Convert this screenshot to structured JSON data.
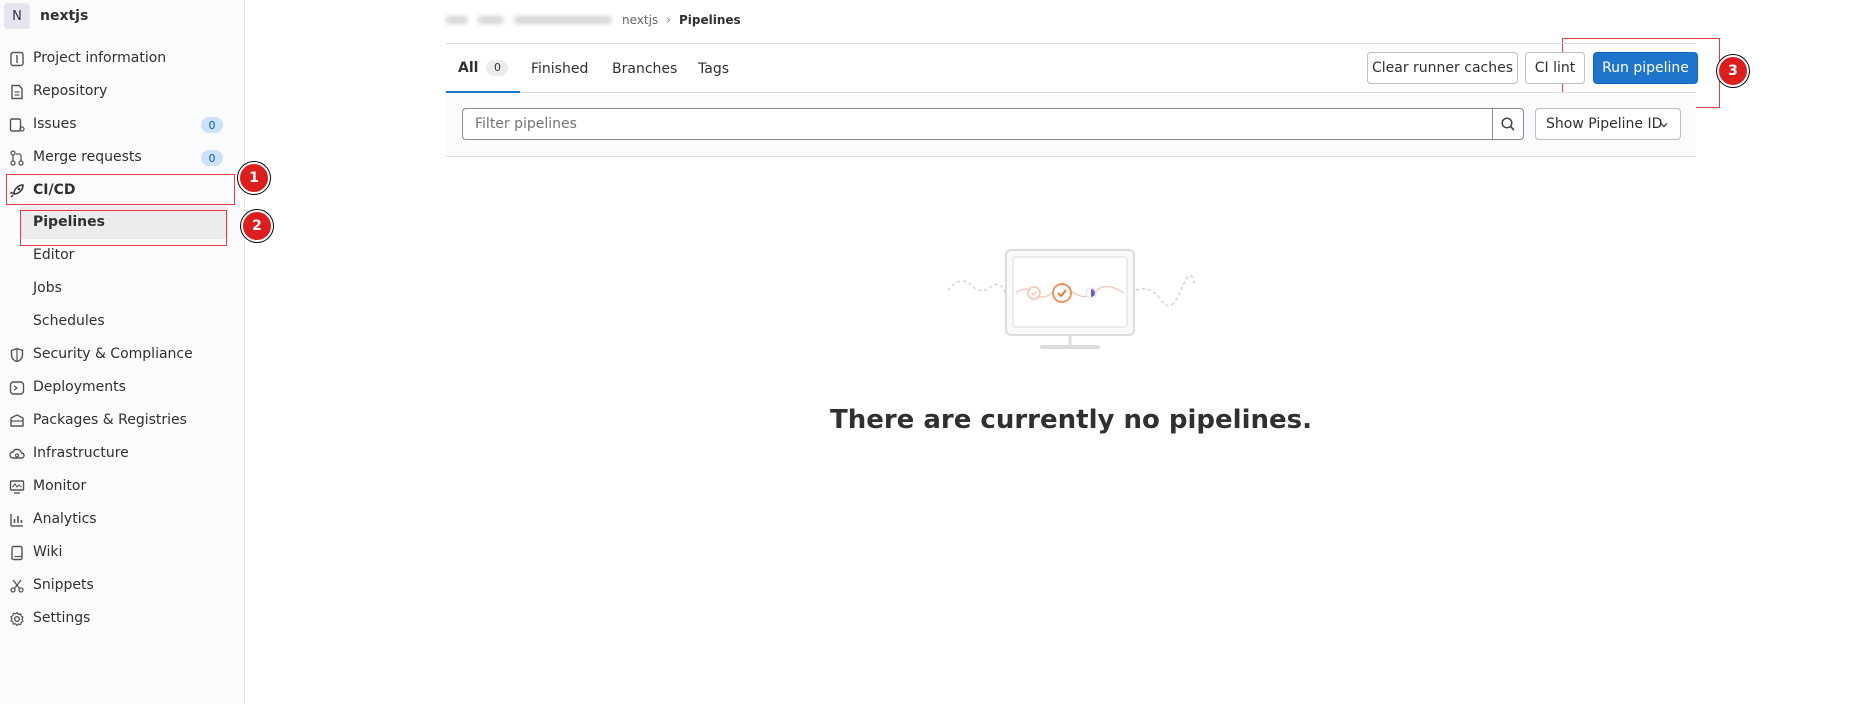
{
  "sidebar": {
    "project_avatar": "N",
    "project_name": "nextjs",
    "items": [
      {
        "label": "Project information",
        "icon": "info-icon"
      },
      {
        "label": "Repository",
        "icon": "document-icon"
      },
      {
        "label": "Issues",
        "icon": "issues-icon",
        "badge": "0"
      },
      {
        "label": "Merge requests",
        "icon": "merge-request-icon",
        "badge": "0"
      },
      {
        "label": "CI/CD",
        "icon": "rocket-icon"
      },
      {
        "label": "Security & Compliance",
        "icon": "shield-icon"
      },
      {
        "label": "Deployments",
        "icon": "deployments-icon"
      },
      {
        "label": "Packages & Registries",
        "icon": "package-icon"
      },
      {
        "label": "Infrastructure",
        "icon": "cloud-gear-icon"
      },
      {
        "label": "Monitor",
        "icon": "monitor-icon"
      },
      {
        "label": "Analytics",
        "icon": "chart-icon"
      },
      {
        "label": "Wiki",
        "icon": "book-icon"
      },
      {
        "label": "Snippets",
        "icon": "scissors-icon"
      },
      {
        "label": "Settings",
        "icon": "gear-icon"
      }
    ],
    "cicd_subitems": [
      {
        "label": "Pipelines",
        "active": true
      },
      {
        "label": "Editor"
      },
      {
        "label": "Jobs"
      },
      {
        "label": "Schedules"
      }
    ]
  },
  "annotations": [
    "1",
    "2",
    "3"
  ],
  "breadcrumb": {
    "project": "nextjs",
    "current": "Pipelines"
  },
  "tabs": [
    {
      "label": "All",
      "count": "0",
      "active": true
    },
    {
      "label": "Finished"
    },
    {
      "label": "Branches"
    },
    {
      "label": "Tags"
    }
  ],
  "actions": {
    "clear_runner_caches": "Clear runner caches",
    "ci_lint": "CI lint",
    "run_pipeline": "Run pipeline"
  },
  "filter": {
    "placeholder": "Filter pipelines",
    "dropdown_label": "Show Pipeline ID"
  },
  "empty_state": {
    "title": "There are currently no pipelines."
  },
  "colors": {
    "primary": "#1f75cb",
    "annotation": "#dd1e1e",
    "badge_bg": "#cbe2f9"
  }
}
